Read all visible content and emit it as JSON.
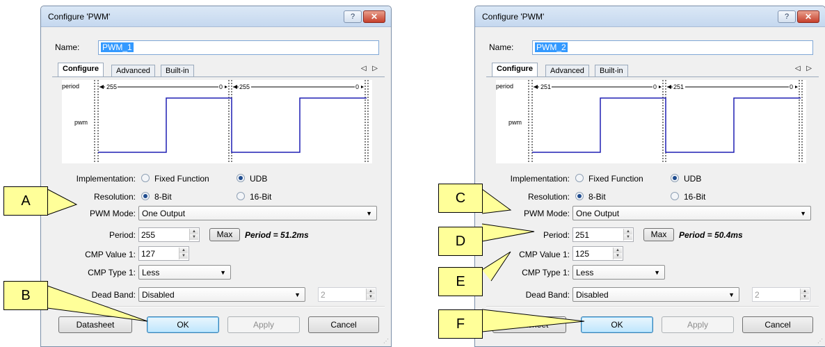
{
  "dialogs": [
    {
      "title": "Configure 'PWM'",
      "help_glyph": "?",
      "close_glyph": "✕",
      "name_label": "Name:",
      "name_value": "PWM_1",
      "tabs": [
        "Configure",
        "Advanced",
        "Built-in"
      ],
      "tab_scroll": "◁ ▷",
      "waveform": {
        "period_label": "period",
        "pwm_label": "pwm",
        "period_left": "255",
        "zero": "0",
        "period_right": "255",
        "zero_end": "0"
      },
      "implementation": {
        "label": "Implementation:",
        "options": [
          "Fixed Function",
          "UDB"
        ],
        "selected": "UDB"
      },
      "resolution": {
        "label": "Resolution:",
        "options": [
          "8-Bit",
          "16-Bit"
        ],
        "selected": "8-Bit"
      },
      "pwm_mode": {
        "label": "PWM Mode:",
        "value": "One Output"
      },
      "period": {
        "label": "Period:",
        "value": "255",
        "max_button": "Max",
        "result": "Period = 51.2ms"
      },
      "cmp_value_1": {
        "label": "CMP Value 1:",
        "value": "127"
      },
      "cmp_type_1": {
        "label": "CMP Type 1:",
        "value": "Less"
      },
      "dead_band": {
        "label": "Dead Band:",
        "value": "Disabled",
        "spin_value": "2"
      },
      "buttons": {
        "datasheet": "Datasheet",
        "ok": "OK",
        "apply": "Apply",
        "cancel": "Cancel"
      }
    },
    {
      "title": "Configure 'PWM'",
      "help_glyph": "?",
      "close_glyph": "✕",
      "name_label": "Name:",
      "name_value": "PWM_2",
      "tabs": [
        "Configure",
        "Advanced",
        "Built-in"
      ],
      "tab_scroll": "◁ ▷",
      "waveform": {
        "period_label": "period",
        "pwm_label": "pwm",
        "period_left": "251",
        "zero": "0",
        "period_right": "251",
        "zero_end": "0"
      },
      "implementation": {
        "label": "Implementation:",
        "options": [
          "Fixed Function",
          "UDB"
        ],
        "selected": "UDB"
      },
      "resolution": {
        "label": "Resolution:",
        "options": [
          "8-Bit",
          "16-Bit"
        ],
        "selected": "8-Bit"
      },
      "pwm_mode": {
        "label": "PWM Mode:",
        "value": "One Output"
      },
      "period": {
        "label": "Period:",
        "value": "251",
        "max_button": "Max",
        "result": "Period = 50.4ms"
      },
      "cmp_value_1": {
        "label": "CMP Value 1:",
        "value": "125"
      },
      "cmp_type_1": {
        "label": "CMP Type 1:",
        "value": "Less"
      },
      "dead_band": {
        "label": "Dead Band:",
        "value": "Disabled",
        "spin_value": "2"
      },
      "buttons": {
        "datasheet": "Datasheet",
        "ok": "OK",
        "apply": "Apply",
        "cancel": "Cancel"
      }
    }
  ],
  "callouts": [
    "A",
    "B",
    "C",
    "D",
    "E",
    "F"
  ],
  "colors": {
    "waveform": "#1f1fb4",
    "callout_fill": "#ffff99",
    "titlebar": "#c5d8ef"
  }
}
